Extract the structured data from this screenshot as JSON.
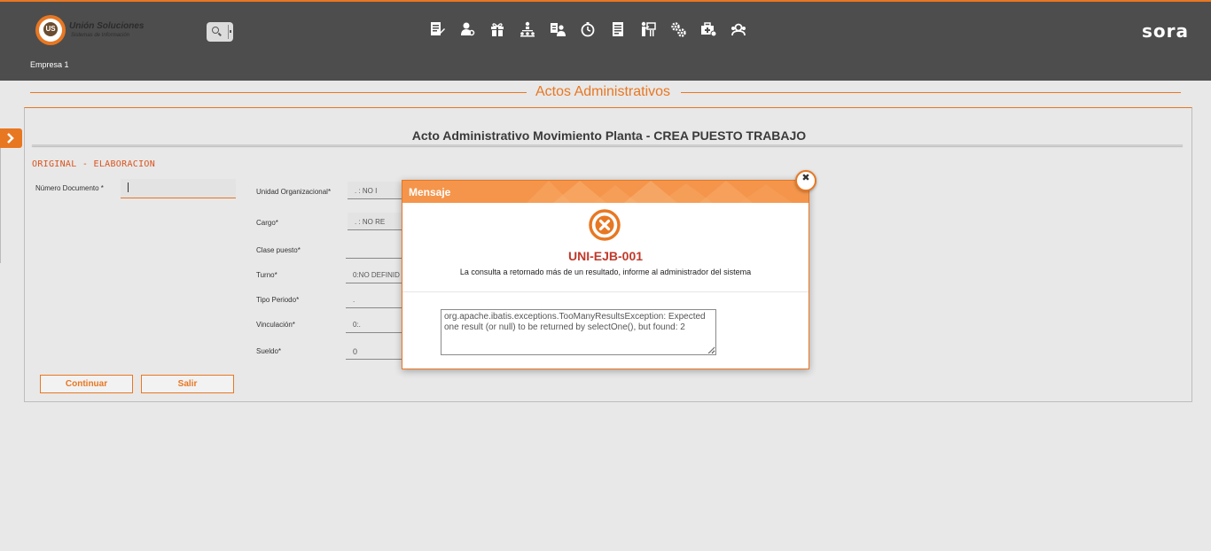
{
  "header": {
    "logo_title": "Unión Soluciones",
    "logo_subtitle": "Sistemas de Información",
    "logo_mark": "US",
    "brand": "sora",
    "company": "Empresa 1",
    "nav_icons": [
      "document-edit-icon",
      "user-settings-icon",
      "gift-icon",
      "org-chart-icon",
      "user-id-icon",
      "stopwatch-icon",
      "report-icon",
      "training-icon",
      "gears-icon",
      "medical-case-icon",
      "users-group-icon"
    ]
  },
  "section": {
    "title": "Actos Administrativos"
  },
  "form": {
    "title": "Acto Administrativo Movimiento Planta - CREA PUESTO TRABAJO",
    "phase": "ORIGINAL - ELABORACION",
    "numero_documento_label": "Número Documento *",
    "unidad_label": "Unidad Organizacional*",
    "unidad_value": ".           : NO I",
    "cargo_label": "Cargo*",
    "cargo_value": ".           : NO RE",
    "clase_label": "Clase puesto*",
    "clase_value": "",
    "turno_label": "Turno*",
    "turno_value": "0:NO DEFINID",
    "tipo_periodo_label": "Tipo Periodo*",
    "tipo_periodo_value": ".",
    "vinculacion_label": "Vinculación*",
    "vinculacion_value": "0:.",
    "sueldo_label": "Sueldo*",
    "sueldo_value": "0",
    "continuar_label": "Continuar",
    "salir_label": "Salir"
  },
  "modal": {
    "title": "Mensaje",
    "close_glyph": "✖",
    "code": "UNI-EJB-001",
    "message": "La consulta a retornado más de un resultado, informe al administrador del sistema",
    "detail": "org.apache.ibatis.exceptions.TooManyResultsException: Expected one result (or null) to be returned by selectOne(), but found: 2"
  },
  "colors": {
    "accent": "#e87722",
    "header_bg": "#4d4d4d",
    "error": "#c0392b",
    "modal_header": "#f4954b"
  }
}
